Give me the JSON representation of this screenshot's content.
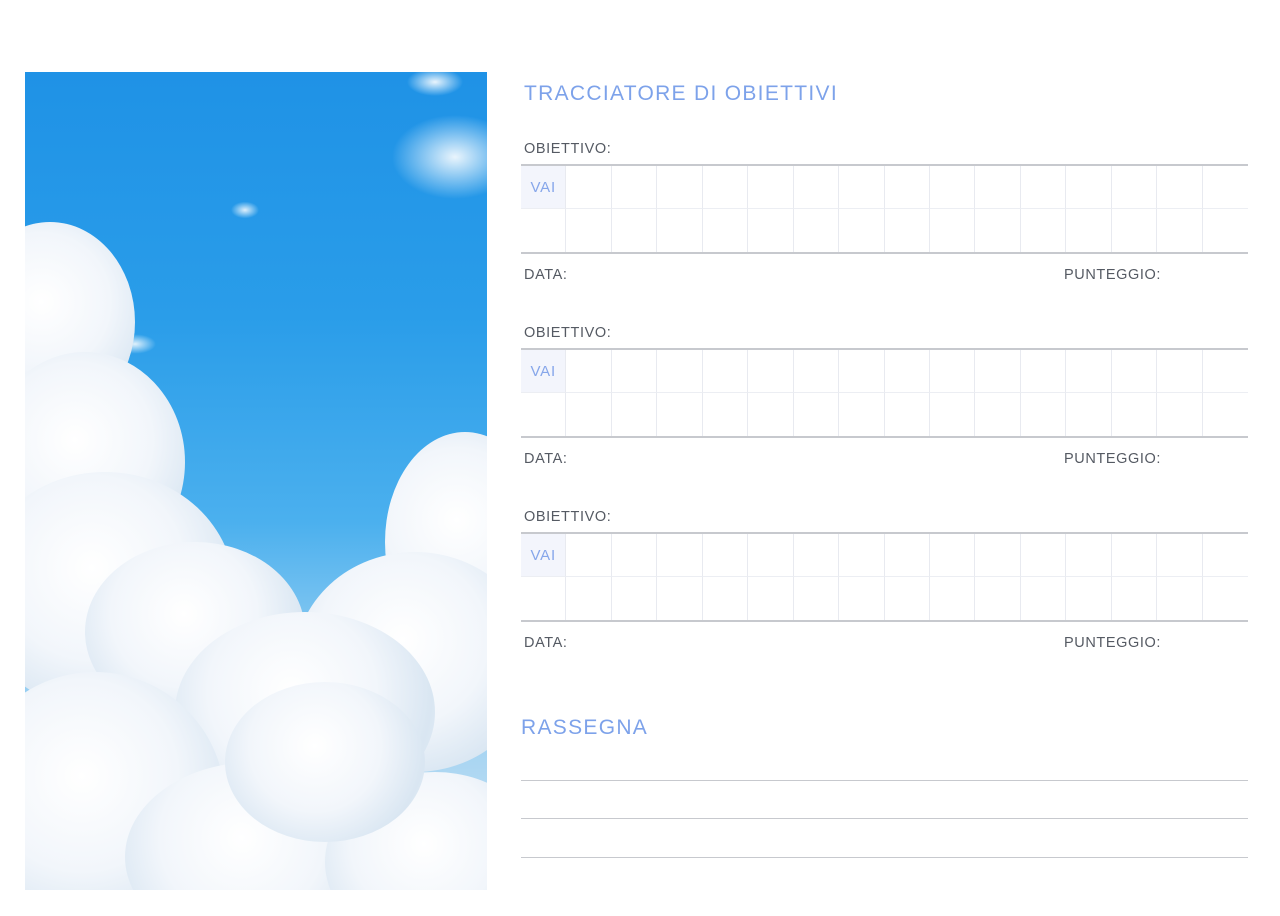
{
  "header": {
    "title": "TRACCIATORE DI OBIETTIVI"
  },
  "goals": [
    {
      "label": "OBIETTIVO:",
      "go": "VAI",
      "date": "DATA:",
      "score": "PUNTEGGIO:"
    },
    {
      "label": "OBIETTIVO:",
      "go": "VAI",
      "date": "DATA:",
      "score": "PUNTEGGIO:"
    },
    {
      "label": "OBIETTIVO:",
      "go": "VAI",
      "date": "DATA:",
      "score": "PUNTEGGIO:"
    }
  ],
  "review": {
    "title": "RASSEGNA",
    "line_count": 3
  },
  "photo": {
    "subject": "sky-with-clouds"
  },
  "colors": {
    "accent": "#7da2ea",
    "text": "#555a63",
    "rule": "#c7c9ce",
    "grid": "#e8eaf0",
    "go_bg": "#f3f5fc"
  }
}
